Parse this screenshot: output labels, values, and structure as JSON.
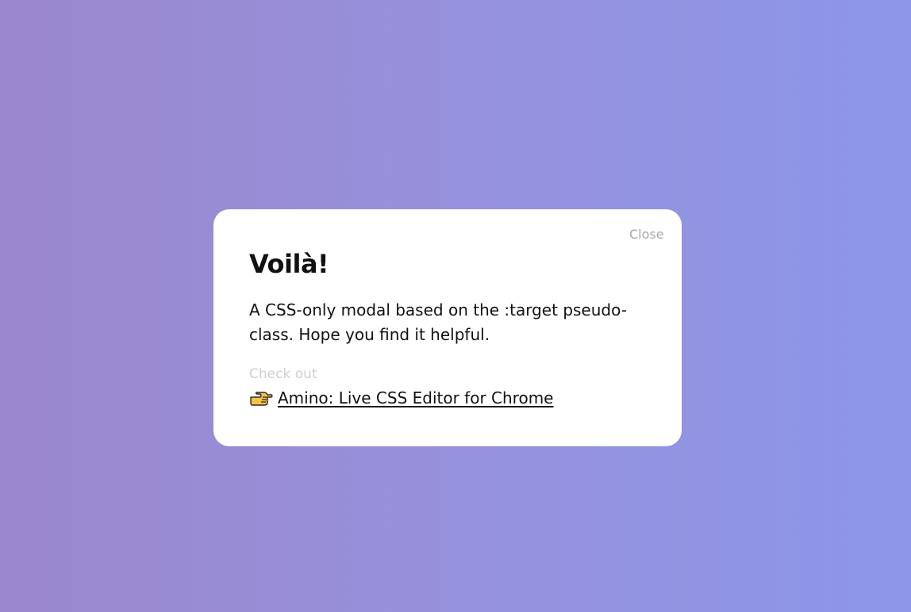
{
  "modal": {
    "close_label": "Close",
    "title": "Voilà!",
    "body": "A CSS-only modal based on the :target pseudo-class. Hope you find it helpful.",
    "checkout_label": "Check out",
    "promo_link_label": "Amino: Live CSS Editor for Chrome",
    "promo_icon": "pointing-hand-icon"
  },
  "colors": {
    "background_gradient_start": "#9b87cd",
    "background_gradient_end": "#8d96e9",
    "modal_background": "#ffffff",
    "close_text": "#a9a9a9",
    "checkout_text": "#cfcfcf",
    "primary_text": "#111111"
  }
}
